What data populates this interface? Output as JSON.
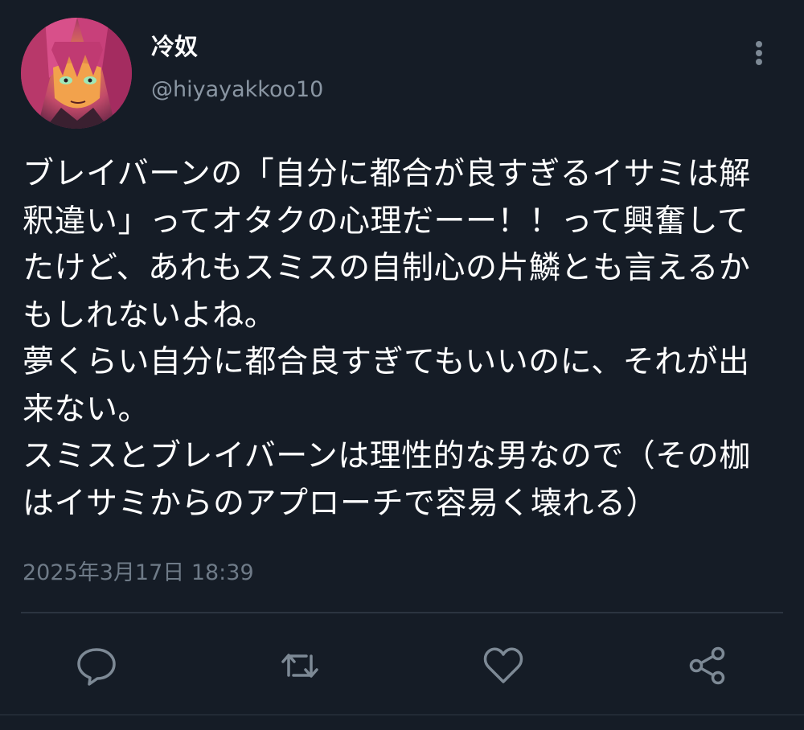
{
  "author": {
    "display_name": "冷奴",
    "handle": "@hiyayakkoo10"
  },
  "tweet": {
    "lines": [
      "ブレイバーンの「自分に都合が良すぎるイサミは解",
      "釈違い」ってオタクの心理だーー！！って興奮して",
      "たけど、あれもスミスの自制心の片鱗とも言えるか",
      "もしれないよね。",
      "夢くらい自分に都合良すぎてもいいのに、それが出",
      "来ない。",
      "スミスとブレイバーンは理性的な男なので（その枷",
      "はイサミからのアプローチで容易く壊れる）"
    ],
    "timestamp": "2025年3月17日 18:39"
  },
  "icons": {
    "more": "more-vertical-icon",
    "reply": "reply-icon",
    "retweet": "retweet-icon",
    "like": "heart-icon",
    "share": "share-icon"
  },
  "colors": {
    "background": "#151c26",
    "text": "#ffffff",
    "handle": "#8a96a3",
    "timestamp": "#6f7b88",
    "icon": "#7d8995",
    "divider": "#2b3440"
  }
}
